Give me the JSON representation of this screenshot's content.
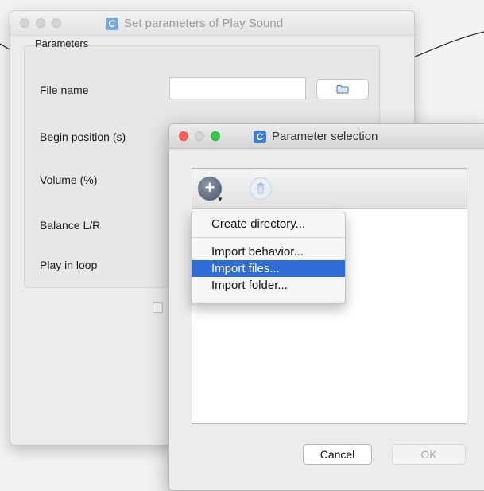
{
  "background_window": {
    "title": "Set parameters of Play Sound",
    "app_icon_letter": "C",
    "group_label": "Parameters",
    "params": [
      {
        "label": "File name"
      },
      {
        "label": "Begin position (s)"
      },
      {
        "label": "Volume (%)"
      },
      {
        "label": "Balance L/R"
      },
      {
        "label": "Play in loop"
      }
    ],
    "file_name_value": ""
  },
  "dialog": {
    "title": "Parameter selection",
    "app_icon_letter": "C",
    "toolbar": {
      "add_icon": "add-icon",
      "delete_icon": "trash-icon"
    },
    "cancel_label": "Cancel",
    "ok_label": "OK"
  },
  "menu": {
    "items": [
      {
        "label": "Create directory..."
      },
      {
        "label": "Import behavior..."
      },
      {
        "label": "Import files...",
        "selected": true
      },
      {
        "label": "Import folder..."
      }
    ]
  },
  "colors": {
    "selection": "#2f6cd6",
    "app_icon": "#3d7fd6"
  }
}
